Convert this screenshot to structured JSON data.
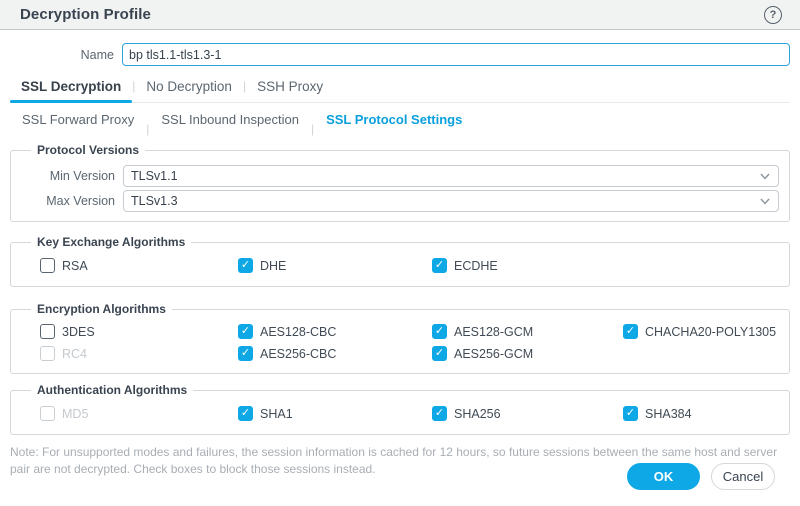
{
  "header": {
    "title": "Decryption Profile",
    "help_icon": "?"
  },
  "name_field": {
    "label": "Name",
    "value": "bp tls1.1-tls1.3-1"
  },
  "tabs": [
    {
      "label": "SSL Decryption",
      "active": true
    },
    {
      "label": "No Decryption",
      "active": false
    },
    {
      "label": "SSH Proxy",
      "active": false
    }
  ],
  "tab_separator": "|",
  "subtabs": [
    {
      "label": "SSL Forward Proxy",
      "active": false
    },
    {
      "label": "SSL Inbound Inspection",
      "active": false
    },
    {
      "label": "SSL Protocol Settings",
      "active": true
    }
  ],
  "protocol_versions": {
    "legend": "Protocol Versions",
    "min": {
      "label": "Min Version",
      "value": "TLSv1.1"
    },
    "max": {
      "label": "Max Version",
      "value": "TLSv1.3"
    }
  },
  "key_exchange": {
    "legend": "Key Exchange Algorithms",
    "items": [
      {
        "label": "RSA",
        "checked": false,
        "disabled": false
      },
      {
        "label": "DHE",
        "checked": true,
        "disabled": false
      },
      {
        "label": "ECDHE",
        "checked": true,
        "disabled": false
      }
    ]
  },
  "encryption": {
    "legend": "Encryption Algorithms",
    "row1": [
      {
        "label": "3DES",
        "checked": false,
        "disabled": false
      },
      {
        "label": "AES128-CBC",
        "checked": true,
        "disabled": false
      },
      {
        "label": "AES128-GCM",
        "checked": true,
        "disabled": false
      },
      {
        "label": "CHACHA20-POLY1305",
        "checked": true,
        "disabled": false
      }
    ],
    "row2": [
      {
        "label": "RC4",
        "checked": false,
        "disabled": true
      },
      {
        "label": "AES256-CBC",
        "checked": true,
        "disabled": false
      },
      {
        "label": "AES256-GCM",
        "checked": true,
        "disabled": false
      }
    ]
  },
  "authentication": {
    "legend": "Authentication Algorithms",
    "items": [
      {
        "label": "MD5",
        "checked": false,
        "disabled": true
      },
      {
        "label": "SHA1",
        "checked": true,
        "disabled": false
      },
      {
        "label": "SHA256",
        "checked": true,
        "disabled": false
      },
      {
        "label": "SHA384",
        "checked": true,
        "disabled": false
      }
    ]
  },
  "note": "Note: For unsupported modes and failures, the session information is cached for 12 hours, so future sessions between the same host and server pair are not decrypted. Check boxes to block those sessions instead.",
  "footer": {
    "ok_label": "OK",
    "cancel_label": "Cancel"
  },
  "icons": {
    "check": "✓"
  },
  "colors": {
    "accent_blue": "#0ea8e6",
    "dark_text": "#38424d",
    "disabled_text": "#c3c9ce"
  }
}
